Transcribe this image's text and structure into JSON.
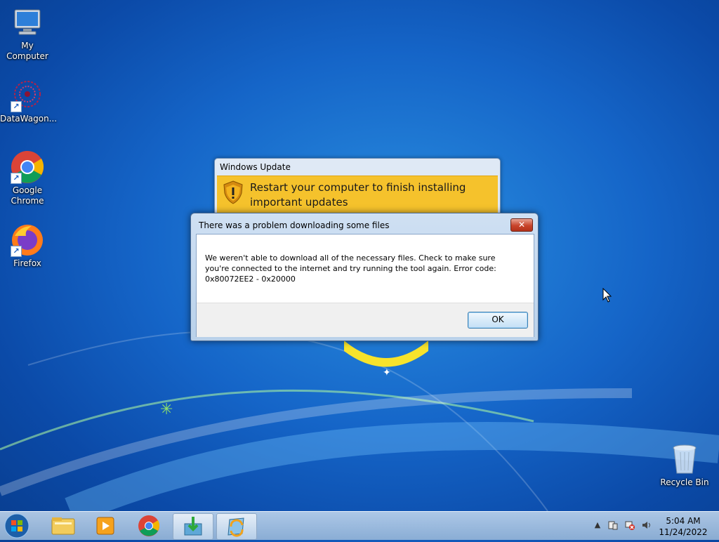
{
  "desktop": {
    "icons": [
      {
        "label": "My Computer"
      },
      {
        "label": "DataWagon..."
      },
      {
        "label": "Google Chrome"
      },
      {
        "label": "Firefox"
      },
      {
        "label": "Recycle Bin"
      }
    ]
  },
  "windows_update": {
    "title": "Windows Update",
    "message": "Restart your computer to finish installing important updates"
  },
  "error_dialog": {
    "title": "There was a problem downloading some files",
    "close_symbol": "✕",
    "body": "We weren't able to download all of the necessary files. Check to make sure you're connected to the internet and try running the tool again. Error code: 0x80072EE2 - 0x20000",
    "ok_label": "OK"
  },
  "taskbar": {
    "pinned": [
      "folder-icon",
      "media-player-icon",
      "chrome-icon",
      "download-tool-icon",
      "windows-update-icon"
    ],
    "clock_time": "5:04 AM",
    "clock_date": "11/24/2022"
  },
  "colors": {
    "banner": "#f5c22c",
    "desktop_blue": "#1565c8"
  }
}
